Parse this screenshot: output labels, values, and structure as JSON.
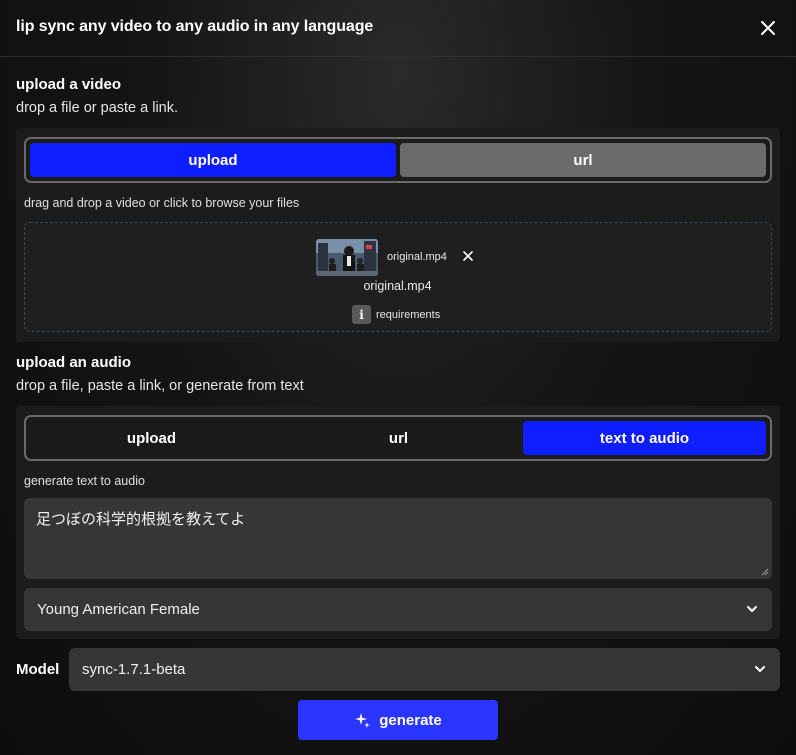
{
  "header": {
    "title": "lip sync any video to any audio in any language"
  },
  "video_section": {
    "title": "upload a video",
    "subtitle": "drop a file or paste a link.",
    "tabs": [
      "upload",
      "url"
    ],
    "active_tab": "upload",
    "helper": "drag and drop a video or click to browse your files",
    "file": {
      "chip_name": "original.mp4",
      "name": "original.mp4"
    },
    "requirements_label": "requirements"
  },
  "audio_section": {
    "title": "upload an audio",
    "subtitle": "drop a file, paste a link, or generate from text",
    "tabs": [
      "upload",
      "url",
      "text to audio"
    ],
    "active_tab": "text to audio",
    "helper": "generate text to audio",
    "text_value": "足つぼの科学的根拠を教えてよ",
    "voice": "Young American Female"
  },
  "model": {
    "label": "Model",
    "value": "sync-1.7.1-beta"
  },
  "generate": {
    "label": "generate",
    "icon": "sparkle-icon"
  },
  "colors": {
    "accent": "#0f1eff",
    "button": "#2a36ff",
    "panel": "#1c1c1c"
  }
}
